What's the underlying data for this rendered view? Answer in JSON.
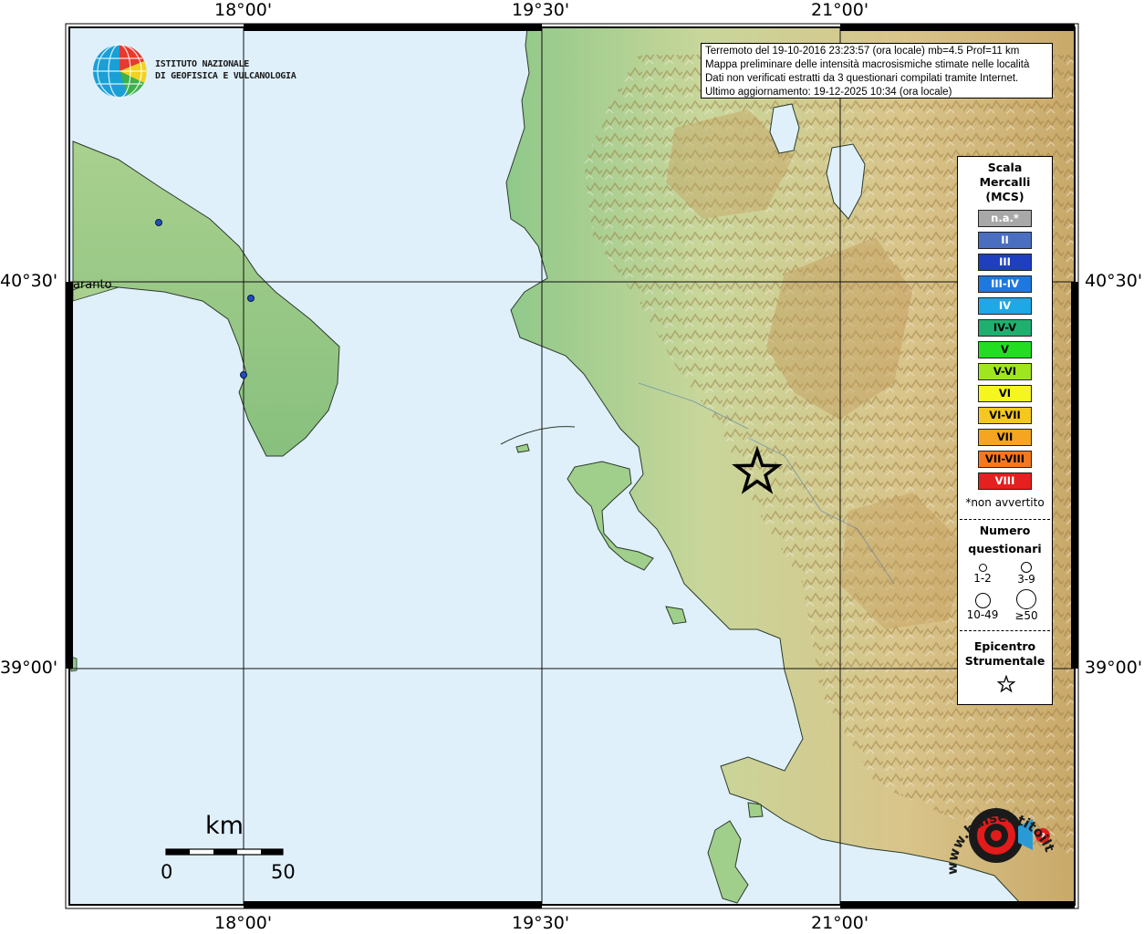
{
  "map": {
    "grid": {
      "top_labels": [
        "18°00'",
        "19°30'",
        "21°00'"
      ],
      "bottom_labels": [
        "18°00'",
        "19°30'",
        "21°00'"
      ],
      "left_labels": [
        "40°30'",
        "39°00'"
      ],
      "right_labels": [
        "40°30'",
        "39°00'"
      ]
    },
    "colors": {
      "sea": "#dff0fb",
      "land_low": "#7fbf7a",
      "land_mid": "#e6d9a6",
      "land_high": "#b48a4a",
      "snow": "#f5f5f5"
    },
    "city": "aranto",
    "epicenter_marker": "star-icon"
  },
  "info": {
    "line1": "Terremoto del 19-10-2016 23:23:57 (ora locale) mb=4.5 Prof=11 km",
    "line2": "Mappa preliminare delle intensità macrosismiche stimate nelle località",
    "line3": "Dati non verificati estratti da 3 questionari compilati tramite Internet.",
    "line4": "Ultimo aggiornamento: 19-12-2025 10:34 (ora locale)"
  },
  "ingv": {
    "line1": "ISTITUTO NAZIONALE",
    "line2": "DI GEOFISICA E VULCANOLOGIA"
  },
  "legend": {
    "title_lines": [
      "Scala",
      "Mercalli",
      "(MCS)"
    ],
    "items": [
      {
        "label": "n.a.*",
        "color": "#a8a8a8",
        "text_color": "#ffffff"
      },
      {
        "label": "II",
        "color": "#4a6fc0",
        "text_color": "#ffffff"
      },
      {
        "label": "III",
        "color": "#1f3fbf",
        "text_color": "#ffffff"
      },
      {
        "label": "III-IV",
        "color": "#1f78e0",
        "text_color": "#ffffff"
      },
      {
        "label": "IV",
        "color": "#1fa8e6",
        "text_color": "#ffffff"
      },
      {
        "label": "IV-V",
        "color": "#1fb070",
        "text_color": "#000000"
      },
      {
        "label": "V",
        "color": "#22dd22",
        "text_color": "#000000"
      },
      {
        "label": "V-VI",
        "color": "#9fe61f",
        "text_color": "#000000"
      },
      {
        "label": "VI",
        "color": "#f5f51f",
        "text_color": "#000000"
      },
      {
        "label": "VI-VII",
        "color": "#f5c81f",
        "text_color": "#000000"
      },
      {
        "label": "VII",
        "color": "#f5a51f",
        "text_color": "#000000"
      },
      {
        "label": "VII-VIII",
        "color": "#f5781f",
        "text_color": "#000000"
      },
      {
        "label": "VIII",
        "color": "#e61f1f",
        "text_color": "#ffffff"
      }
    ],
    "not_felt_note": "*non avvertito",
    "questionnaires_title": [
      "Numero",
      "questionari"
    ],
    "questionnaire_sizes": [
      "1-2",
      "3-9",
      "10-49",
      "≥50"
    ],
    "epicenter_title": [
      "Epicentro",
      "Strumentale"
    ]
  },
  "scale_bar": {
    "unit": "km",
    "start": "0",
    "end": "50"
  },
  "hst": {
    "text": "www.haisentitoilterremoto.it"
  }
}
